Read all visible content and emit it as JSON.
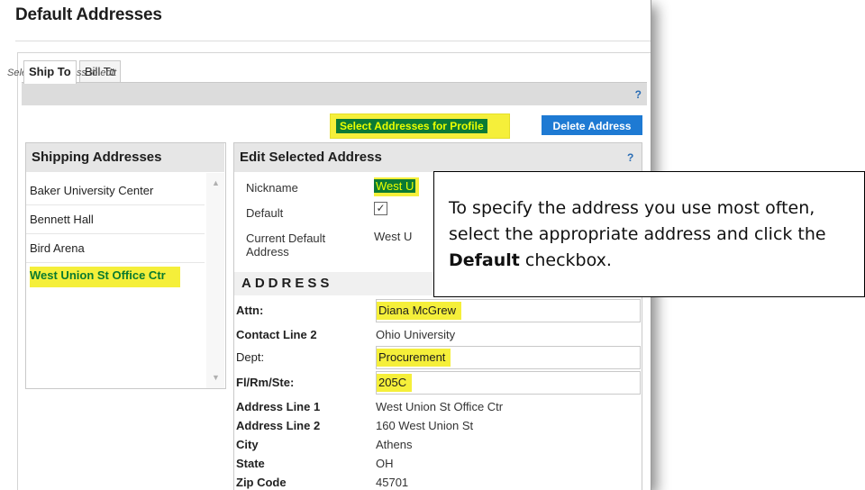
{
  "page": {
    "title": "Default Addresses"
  },
  "tabs": [
    {
      "label": "Ship To",
      "active": true
    },
    {
      "label": "Bill To",
      "active": false
    }
  ],
  "toolbar": {
    "help": "?",
    "instruction": "Select an address to edit",
    "select_button": "Select Addresses for Profile",
    "delete_button": "Delete Address"
  },
  "shipping": {
    "title": "Shipping Addresses",
    "items": [
      {
        "label": "Baker University Center"
      },
      {
        "label": "Bennett Hall"
      },
      {
        "label": "Bird Arena"
      },
      {
        "label": "West Union St Office Ctr",
        "selected": true
      }
    ]
  },
  "edit": {
    "title": "Edit Selected Address",
    "help": "?",
    "nickname_label": "Nickname",
    "nickname_value": "West U",
    "default_label": "Default",
    "default_checked": true,
    "current_default_label_1": "Current Default",
    "current_default_label_2": "Address",
    "current_default_value": "West U",
    "address_heading": "ADDRESS",
    "rows": [
      {
        "label": "Attn:",
        "value": "Diana McGrew",
        "input": true,
        "bold": true
      },
      {
        "label": "Contact Line 2",
        "value": "Ohio University",
        "input": false,
        "bold": true
      },
      {
        "label": "Dept:",
        "value": "Procurement",
        "input": true,
        "bold": false
      },
      {
        "label": "Fl/Rm/Ste:",
        "value": "205C",
        "input": true,
        "bold": true
      },
      {
        "label": "Address Line 1",
        "value": "West Union St Office Ctr",
        "input": false,
        "bold": true
      },
      {
        "label": "Address Line 2",
        "value": "160 West Union St",
        "input": false,
        "bold": true
      },
      {
        "label": "City",
        "value": "Athens",
        "input": false,
        "bold": true
      },
      {
        "label": "State",
        "value": "OH",
        "input": false,
        "bold": true
      },
      {
        "label": "Zip Code",
        "value": "45701",
        "input": false,
        "bold": true
      }
    ]
  },
  "callout": {
    "text_1": "To specify the address you use most often, select the appropriate address and click the ",
    "bold": "Default",
    "text_2": " checkbox."
  },
  "colors": {
    "highlight": "#f5ef3a",
    "highlight_text_bg": "#0c7a34",
    "selected_text": "#0a7a2f",
    "delete_button": "#1e7ad3",
    "help_icon": "#2a6db5"
  }
}
